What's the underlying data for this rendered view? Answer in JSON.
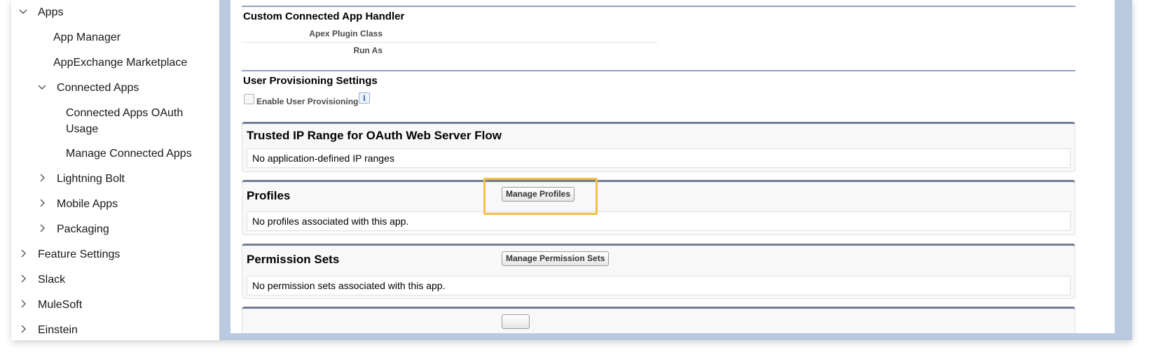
{
  "sidebar": {
    "items": [
      {
        "label": "Apps",
        "chevron": "chevron-down-icon"
      },
      {
        "label": "App Manager"
      },
      {
        "label": "AppExchange Marketplace"
      },
      {
        "label": "Connected Apps",
        "chevron": "chevron-down-icon"
      },
      {
        "label": "Connected Apps OAuth Usage"
      },
      {
        "label": "Manage Connected Apps"
      },
      {
        "label": "Lightning Bolt",
        "chevron": "chevron-right-icon"
      },
      {
        "label": "Mobile Apps",
        "chevron": "chevron-right-icon"
      },
      {
        "label": "Packaging",
        "chevron": "chevron-right-icon"
      },
      {
        "label": "Feature Settings",
        "chevron": "chevron-right-icon"
      },
      {
        "label": "Slack",
        "chevron": "chevron-right-icon"
      },
      {
        "label": "MuleSoft",
        "chevron": "chevron-right-icon"
      },
      {
        "label": "Einstein",
        "chevron": "chevron-right-icon"
      }
    ]
  },
  "handler": {
    "title": "Custom Connected App Handler",
    "apex_plugin_label": "Apex Plugin Class",
    "run_as_label": "Run As"
  },
  "provisioning": {
    "title": "User Provisioning Settings",
    "enable_label": "Enable User Provisioning",
    "info_glyph": "i"
  },
  "trusted_ip": {
    "title": "Trusted IP Range for OAuth Web Server Flow",
    "body": "No application-defined IP ranges"
  },
  "profiles": {
    "title": "Profiles",
    "button": "Manage Profiles",
    "body": "No profiles associated with this app."
  },
  "permission_sets": {
    "title": "Permission Sets",
    "button": "Manage Permission Sets",
    "body": "No permission sets associated with this app."
  },
  "colors": {
    "highlight": "#f2c04a",
    "rule": "#8fa3bf",
    "panel_top": "#6f7c91",
    "frame": "#b8c9e0"
  }
}
